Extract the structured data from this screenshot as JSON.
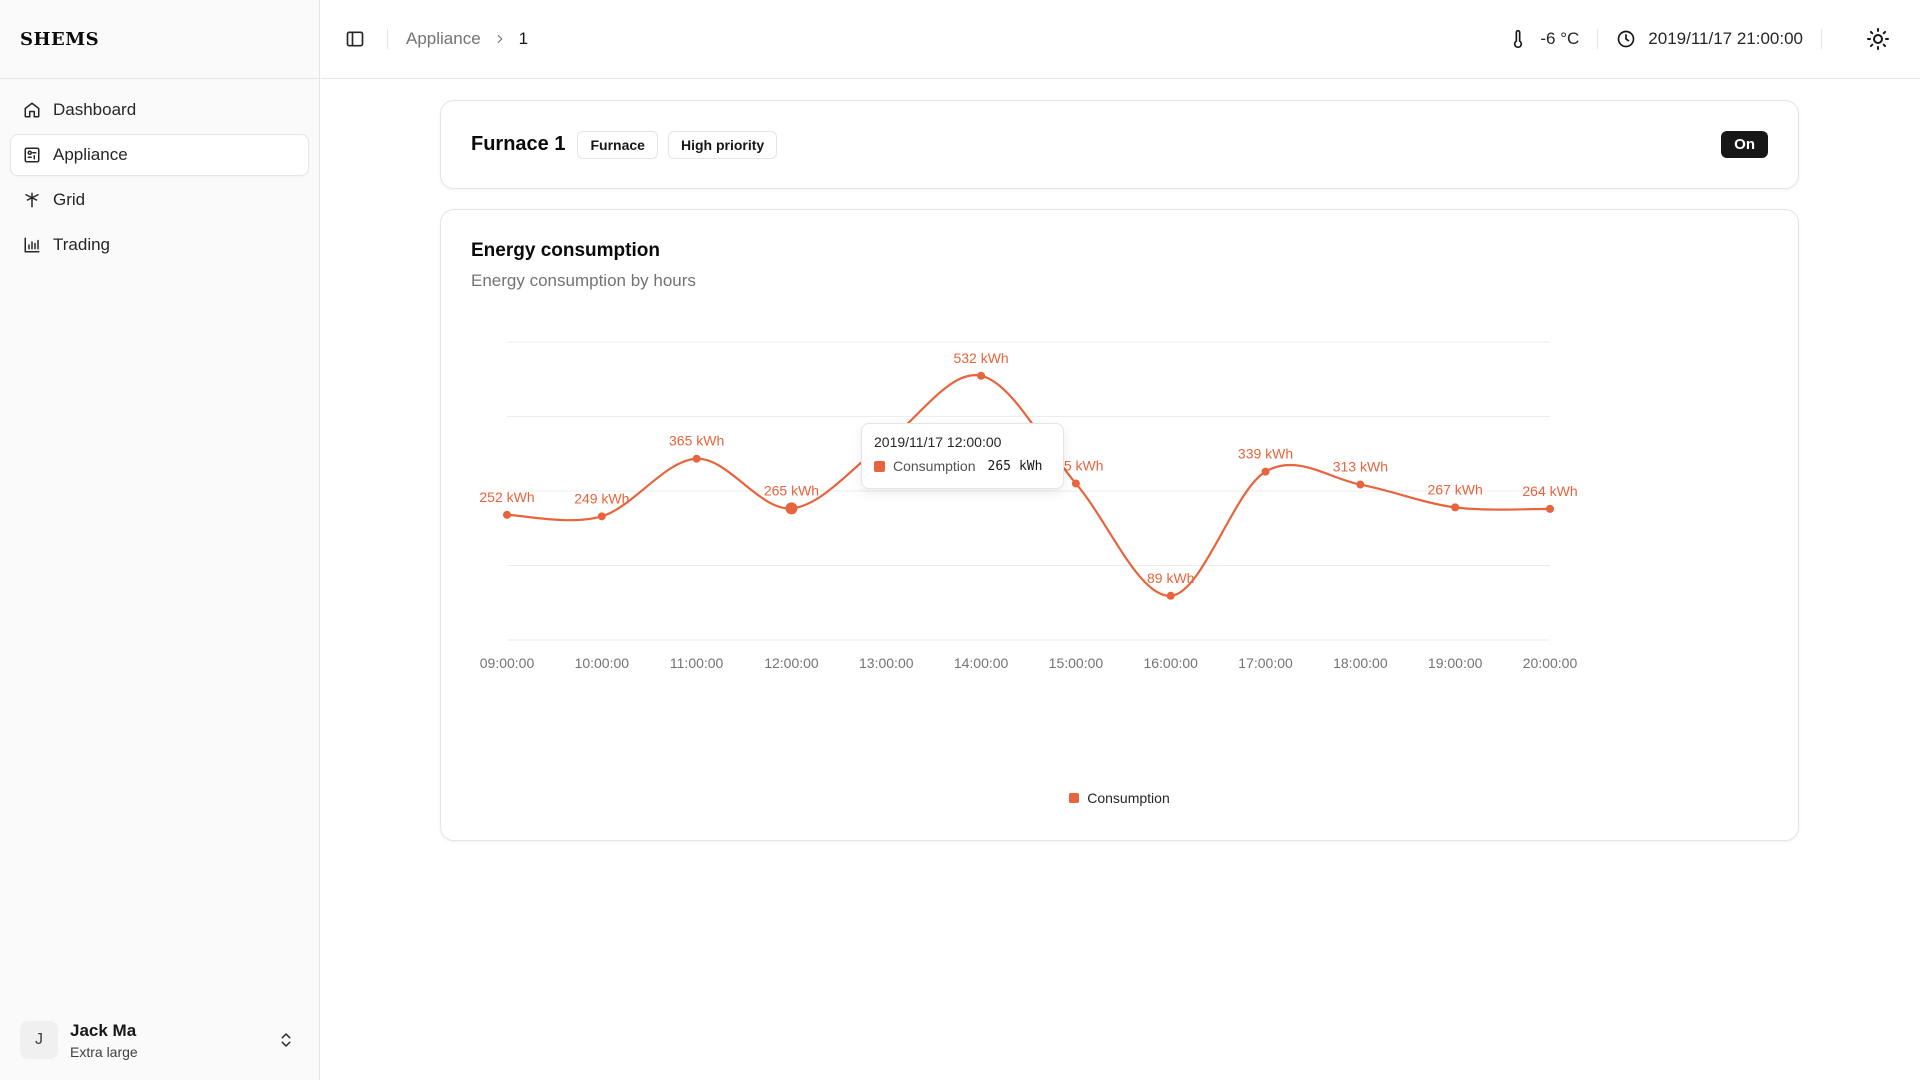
{
  "brand": "SHEMS",
  "sidebar": {
    "items": [
      {
        "label": "Dashboard",
        "icon": "home-icon"
      },
      {
        "label": "Appliance",
        "icon": "appliance-icon",
        "active": true
      },
      {
        "label": "Grid",
        "icon": "grid-tower-icon"
      },
      {
        "label": "Trading",
        "icon": "chart-bars-icon"
      }
    ]
  },
  "user": {
    "initial": "J",
    "name": "Jack Ma",
    "plan": "Extra large"
  },
  "topbar": {
    "breadcrumb": [
      "Appliance",
      "1"
    ],
    "temperature": "-6 °C",
    "datetime": "2019/11/17 21:00:00"
  },
  "appliance": {
    "name": "Furnace 1",
    "type_badge": "Furnace",
    "priority_badge": "High priority",
    "status": "On"
  },
  "chart_card": {
    "title": "Energy consumption",
    "subtitle": "Energy consumption by hours"
  },
  "tooltip": {
    "time": "2019/11/17 12:00:00",
    "series": "Consumption",
    "value": "265",
    "unit": "kWh"
  },
  "colors": {
    "accent": "#e8643c",
    "grid": "#ececec"
  },
  "chart_data": {
    "type": "line",
    "categories": [
      "09:00:00",
      "10:00:00",
      "11:00:00",
      "12:00:00",
      "13:00:00",
      "14:00:00",
      "15:00:00",
      "16:00:00",
      "17:00:00",
      "18:00:00",
      "19:00:00",
      "20:00:00"
    ],
    "series": [
      {
        "name": "Consumption",
        "values": [
          252,
          249,
          365,
          265,
          null,
          532,
          315,
          89,
          339,
          313,
          267,
          264
        ]
      }
    ],
    "value_labels": [
      "252 kWh",
      "249 kWh",
      "365 kWh",
      "265 kWh",
      null,
      "532 kWh",
      "315 kWh",
      "89 kWh",
      "339 kWh",
      "313 kWh",
      "267 kWh",
      "264 kWh"
    ],
    "highlight_index": 3,
    "ylim": [
      0,
      600
    ],
    "grid": true,
    "legend": "bottom"
  }
}
